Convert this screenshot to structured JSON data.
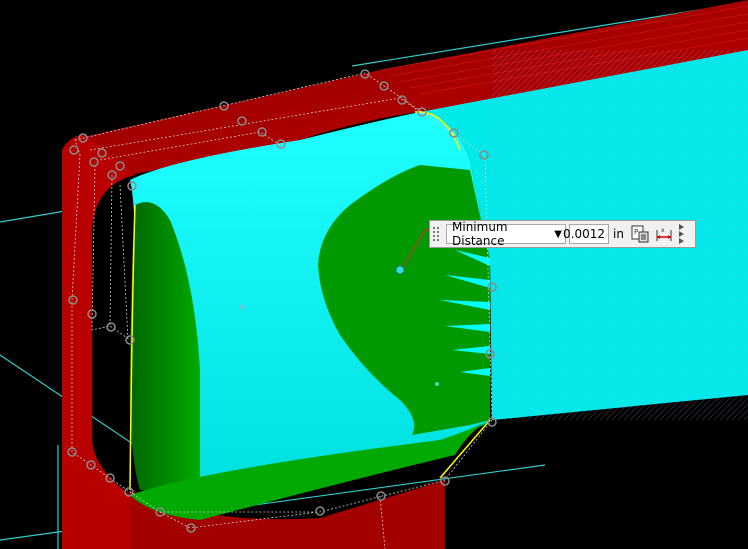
{
  "toolbar": {
    "measure_type": "Minimum Distance",
    "value": "0.0012",
    "unit": "in"
  },
  "icons": {
    "grip": "grip-handle-icon",
    "dropdown": "caret-down-icon",
    "copy": "copy-to-clipboard-icon",
    "dimension": "dimension-measure-icon",
    "overflow": "overflow-chevron-icon"
  },
  "colors": {
    "background": "#000000",
    "frame_red": "#c00000",
    "measured_surface_cyan": "#00ffff",
    "deviation_green": "#009900",
    "construction_line": "#33cccc"
  }
}
